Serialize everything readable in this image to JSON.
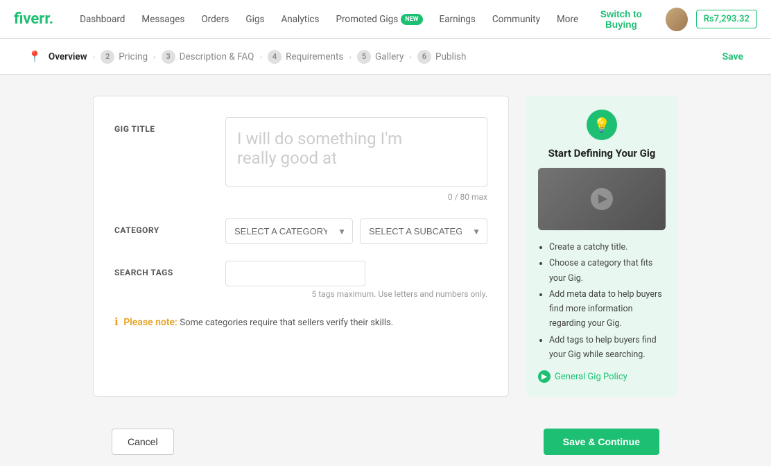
{
  "header": {
    "logo": "fiverr.",
    "nav_items": [
      {
        "label": "Dashboard",
        "id": "dashboard"
      },
      {
        "label": "Messages",
        "id": "messages"
      },
      {
        "label": "Orders",
        "id": "orders"
      },
      {
        "label": "Gigs",
        "id": "gigs"
      },
      {
        "label": "Analytics",
        "id": "analytics"
      },
      {
        "label": "Promoted Gigs",
        "id": "promoted-gigs"
      },
      {
        "label": "Earnings",
        "id": "earnings"
      },
      {
        "label": "Community",
        "id": "community"
      },
      {
        "label": "More",
        "id": "more"
      }
    ],
    "new_badge": "NEW",
    "switch_buying": "Switch to Buying",
    "balance": "Rs7,293.32"
  },
  "breadcrumb": {
    "steps": [
      {
        "num": "1",
        "label": "Overview",
        "active": true
      },
      {
        "num": "2",
        "label": "Pricing",
        "active": false
      },
      {
        "num": "3",
        "label": "Description & FAQ",
        "active": false
      },
      {
        "num": "4",
        "label": "Requirements",
        "active": false
      },
      {
        "num": "5",
        "label": "Gallery",
        "active": false
      },
      {
        "num": "6",
        "label": "Publish",
        "active": false
      }
    ],
    "save_label": "Save"
  },
  "form": {
    "gig_title_label": "GIG TITLE",
    "gig_title_placeholder": "I will do something I'm\nreally good at",
    "char_count": "0 / 80 max",
    "category_label": "CATEGORY",
    "category_placeholder": "SELECT A CATEGORY",
    "subcategory_placeholder": "SELECT A SUBCATEGORY",
    "search_tags_label": "SEARCH TAGS",
    "search_tags_hint": "5 tags maximum. Use letters and numbers only.",
    "notice_icon": "ℹ",
    "notice_label": "Please note:",
    "notice_text": "Some categories require that sellers verify their skills."
  },
  "info_card": {
    "title": "Start Defining Your Gig",
    "tips": [
      "Create a catchy title.",
      "Choose a category that fits your Gig.",
      "Add meta data to help buyers find more information regarding your Gig.",
      "Add tags to help buyers find your Gig while searching."
    ],
    "policy_label": "General Gig Policy"
  },
  "buttons": {
    "cancel": "Cancel",
    "save_continue": "Save & Continue"
  }
}
